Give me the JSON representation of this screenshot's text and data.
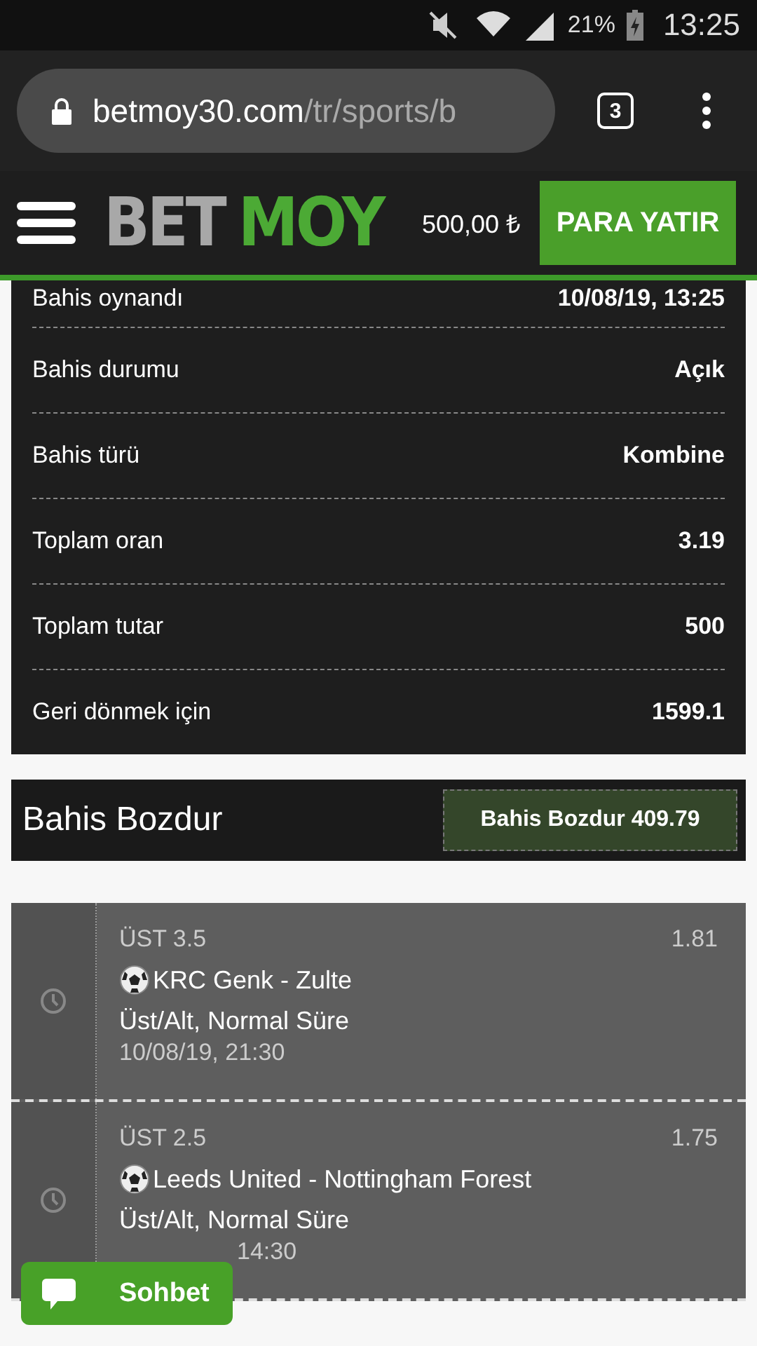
{
  "status_bar": {
    "battery": "21%",
    "time": "13:25"
  },
  "browser": {
    "url_host": "betmoy30.com",
    "url_path": "/tr/sports/b",
    "tab_count": "3"
  },
  "header": {
    "logo_left": "BET",
    "logo_right": "MOY",
    "balance": "500,00 ₺",
    "deposit_button": "PARA YATIR"
  },
  "details": [
    {
      "label": "Bahis oynandı",
      "value": "10/08/19, 13:25"
    },
    {
      "label": "Bahis durumu",
      "value": "Açık"
    },
    {
      "label": "Bahis türü",
      "value": "Kombine"
    },
    {
      "label": "Toplam oran",
      "value": "3.19"
    },
    {
      "label": "Toplam tutar",
      "value": "500"
    },
    {
      "label": "Geri dönmek için",
      "value": "1599.1"
    }
  ],
  "cashout": {
    "title": "Bahis Bozdur",
    "button": "Bahis Bozdur 409.79"
  },
  "bets": [
    {
      "pick": "ÜST 3.5",
      "odds": "1.81",
      "match": "KRC Genk - Zulte",
      "market": "Üst/Alt, Normal Süre",
      "date": "10/08/19, 21:30",
      "covered": false
    },
    {
      "pick": "ÜST 2.5",
      "odds": "1.75",
      "match": "Leeds United - Nottingham Forest",
      "market": "Üst/Alt, Normal Süre",
      "date": "14:30",
      "covered": true
    }
  ],
  "chat_button": "Sohbet"
}
